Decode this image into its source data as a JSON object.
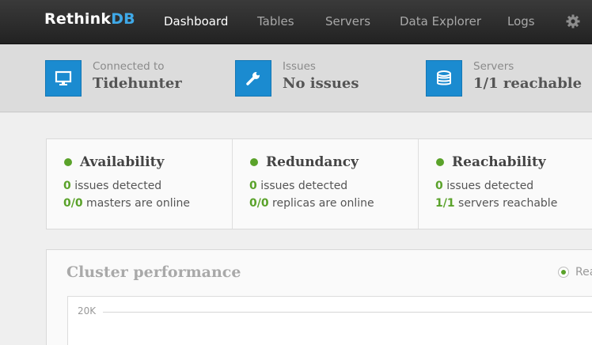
{
  "brand": {
    "name_main": "Rethink",
    "name_accent": "DB",
    "accent_color": "#3fa9e8"
  },
  "nav": {
    "items": [
      {
        "label": "Dashboard",
        "active": true
      },
      {
        "label": "Tables",
        "active": false
      },
      {
        "label": "Servers",
        "active": false
      },
      {
        "label": "Data Explorer",
        "active": false
      },
      {
        "label": "Logs",
        "active": false
      }
    ],
    "settings_icon": "gear-icon"
  },
  "status": {
    "connected": {
      "caption": "Connected to",
      "value": "Tidehunter",
      "icon": "monitor-icon"
    },
    "issues": {
      "caption": "Issues",
      "value": "No issues",
      "icon": "wrench-icon"
    },
    "servers": {
      "caption": "Servers",
      "value": "1/1 reachable",
      "icon": "database-icon"
    },
    "icon_color": "#1b8bd0"
  },
  "cards": [
    {
      "title": "Availability",
      "line1_num": "0",
      "line1_text": " issues detected",
      "line2_num": "0/0",
      "line2_text": " masters are online"
    },
    {
      "title": "Redundancy",
      "line1_num": "0",
      "line1_text": " issues detected",
      "line2_num": "0/0",
      "line2_text": " replicas are online"
    },
    {
      "title": "Reachability",
      "line1_num": "0",
      "line1_text": " issues detected",
      "line2_num": "1/1",
      "line2_text": " servers reachable"
    }
  ],
  "status_color": "#5aa22a",
  "performance": {
    "title": "Cluster performance",
    "legend_label": "Rea",
    "y_tick": "20K"
  }
}
